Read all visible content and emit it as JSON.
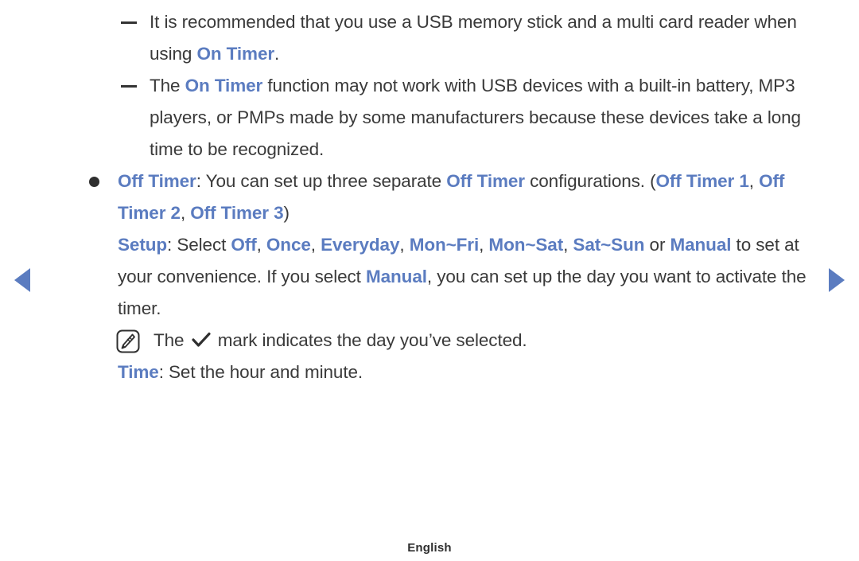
{
  "page": {
    "footer_language": "English",
    "accent_color": "#5b7cc0",
    "text_color": "#3a3a3a",
    "background_color": "#ffffff"
  },
  "nav": {
    "prev_label": "previous-page-arrow",
    "next_label": "next-page-arrow"
  },
  "content": {
    "item1": {
      "marker": "–",
      "p1": "It is recommended that you use a USB memory stick and a multi card reader when using ",
      "hl1": "On Timer",
      "p2": "."
    },
    "item2": {
      "marker": "–",
      "p1": "The ",
      "hl1": "On Timer",
      "p2": " function may not work with USB devices with a built-in battery, MP3 players, or PMPs made by some manufacturers because these devices take a long time to be recognized."
    },
    "item3": {
      "marker": "•",
      "hl1": "Off Timer",
      "p1": ": You can set up three separate ",
      "hl2": "Off Timer",
      "p2": " configurations. (",
      "hl3": "Off Timer 1",
      "p3": ", ",
      "hl4": "Off Timer 2",
      "p4": ", ",
      "hl5": "Off Timer 3",
      "p5": ")"
    },
    "item4": {
      "hl1": "Setup",
      "p1": ": Select ",
      "hl2": "Off",
      "p2": ", ",
      "hl3": "Once",
      "p3": ", ",
      "hl4": "Everyday",
      "p4": ", ",
      "hl5": "Mon~Fri",
      "p5": ", ",
      "hl6": "Mon~Sat",
      "p6": ", ",
      "hl7": "Sat~Sun",
      "p7": " or ",
      "hl8": "Manual",
      "p8": " to set at your convenience. If you select ",
      "hl9": "Manual",
      "p9": ", you can set up the day you want to activate the timer."
    },
    "note1": {
      "icon": "note-pencil-icon",
      "p1": "The ",
      "check_icon": "checkmark-icon",
      "p2": " mark indicates the day you’ve selected."
    },
    "item5": {
      "hl1": "Time",
      "p1": ": Set the hour and minute."
    }
  }
}
